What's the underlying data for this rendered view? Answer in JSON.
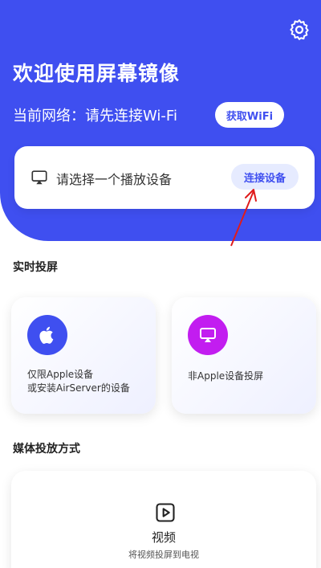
{
  "header": {
    "title": "欢迎使用屏幕镜像",
    "network_label": "当前网络：请先连接Wi-Fi",
    "wifi_button": "获取WiFi",
    "settings_icon": "gear-icon"
  },
  "device_card": {
    "text": "请选择一个播放设备",
    "connect_button": "连接设备",
    "icon": "airplay-icon"
  },
  "realtime": {
    "title": "实时投屏",
    "apple_card": {
      "line1": "仅限Apple设备",
      "line2": "或安装AirServer的设备",
      "icon": "apple-icon"
    },
    "other_card": {
      "label": "非Apple设备投屏",
      "icon": "airplay-icon"
    }
  },
  "media": {
    "title": "媒体投放方式",
    "video_card": {
      "label": "视频",
      "sub": "将视频投屏到电视",
      "icon": "video-play-icon"
    }
  },
  "colors": {
    "primary": "#3f4ff0",
    "apple_icon_bg": "#3f4ff0",
    "airplay_icon_bg": "#c21df0",
    "annotation_arrow": "#e01b1b"
  }
}
